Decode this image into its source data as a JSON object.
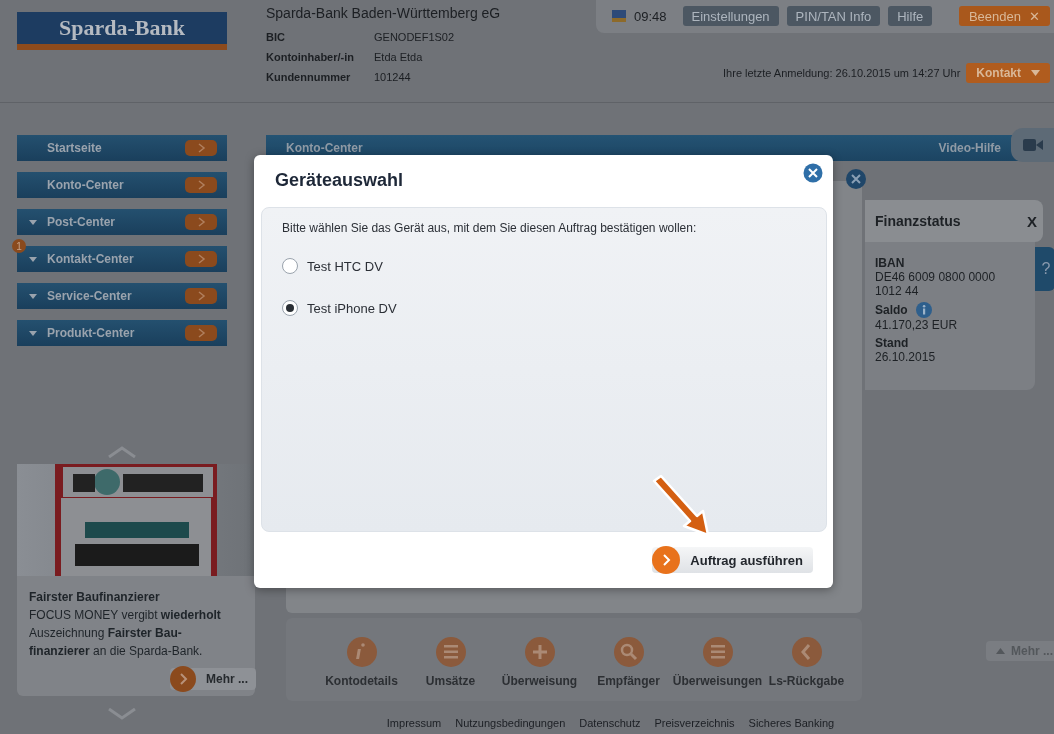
{
  "header": {
    "logo": "Sparda-Bank",
    "bank_name": "Sparda-Bank Baden-Württemberg eG",
    "details": [
      {
        "label": "BIC",
        "value": "GENODEF1S02"
      },
      {
        "label": "Kontoinhaber/-in",
        "value": "Etda Etda"
      },
      {
        "label": "Kundennummer",
        "value": "101244"
      }
    ],
    "time": "09:48",
    "top_buttons": [
      {
        "label": "Einstellungen",
        "kind": "plain"
      },
      {
        "label": "PIN/TAN Info",
        "kind": "plain"
      },
      {
        "label": "Hilfe",
        "kind": "plain"
      },
      {
        "label": "Beenden",
        "kind": "exit",
        "icon": "✕"
      }
    ],
    "last_login": "Ihre letzte Anmeldung: 26.10.2015 um 14:27 Uhr",
    "contact_button": "Kontakt"
  },
  "sidebar": {
    "items": [
      {
        "label": "Startseite",
        "expandable": false
      },
      {
        "label": "Konto-Center",
        "expandable": false
      },
      {
        "label": "Post-Center",
        "expandable": true
      },
      {
        "label": "Kontakt-Center",
        "expandable": true,
        "badge": "1"
      },
      {
        "label": "Service-Center",
        "expandable": true
      },
      {
        "label": "Produkt-Center",
        "expandable": true
      }
    ]
  },
  "promo": {
    "title": "Fairster Baufinanzierer",
    "text": "FOCUS MONEY vergibt **wiederholt** Auszeichnung **Fairster Bau-finanzierer** an die Sparda-Bank.",
    "more_button": "Mehr ..."
  },
  "main": {
    "title_bar": "Konto-Center",
    "video_help": "Video-Hilfe",
    "finanzstatus": {
      "title": "Finanzstatus",
      "close": "X",
      "help_tab": "?",
      "fields": [
        {
          "label": "IBAN",
          "value": "DE46 6009 0800 0000 1012 44",
          "info": false
        },
        {
          "label": "Saldo",
          "value": "41.170,23 EUR",
          "info": true
        },
        {
          "label": "Stand",
          "value": "26.10.2015",
          "info": false
        }
      ]
    },
    "actions": [
      {
        "label": "Kontodetails",
        "kind": "info"
      },
      {
        "label": "Umsätze",
        "kind": "list"
      },
      {
        "label": "Überweisung",
        "kind": "plus"
      },
      {
        "label": "Empfänger",
        "kind": "search"
      },
      {
        "label": "Überweisungen",
        "kind": "list"
      },
      {
        "label": "Ls-Rückgabe",
        "kind": "back"
      }
    ],
    "more_button": "Mehr ..."
  },
  "footer_links": [
    "Impressum",
    "Nutzungsbedingungen",
    "Datenschutz",
    "Preisverzeichnis",
    "Sicheres Banking"
  ],
  "dialog": {
    "title": "Geräteauswahl",
    "prompt": "Bitte wählen Sie das Gerät aus, mit dem Sie diesen Auftrag bestätigen wollen:",
    "options": [
      {
        "label": "Test HTC DV",
        "selected": false
      },
      {
        "label": "Test iPhone DV",
        "selected": true
      }
    ],
    "submit": "Auftrag ausführen"
  }
}
